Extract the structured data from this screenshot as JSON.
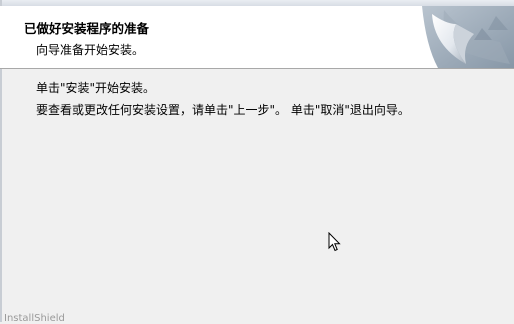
{
  "header": {
    "title": "已做好安装程序的准备",
    "subtitle": "向导准备开始安装。",
    "graphic_icon": "installshield-page-curl-graphic"
  },
  "body": {
    "line1": "单击\"安装\"开始安装。",
    "line2": "要查看或更改任何安装设置，请单击\"上一步\"。 单击\"取消\"退出向导。"
  },
  "footer": {
    "brand": "InstallShield"
  },
  "colors": {
    "background": "#f0f0f0",
    "header_background": "#ffffff",
    "separator": "#a8a8a8"
  }
}
